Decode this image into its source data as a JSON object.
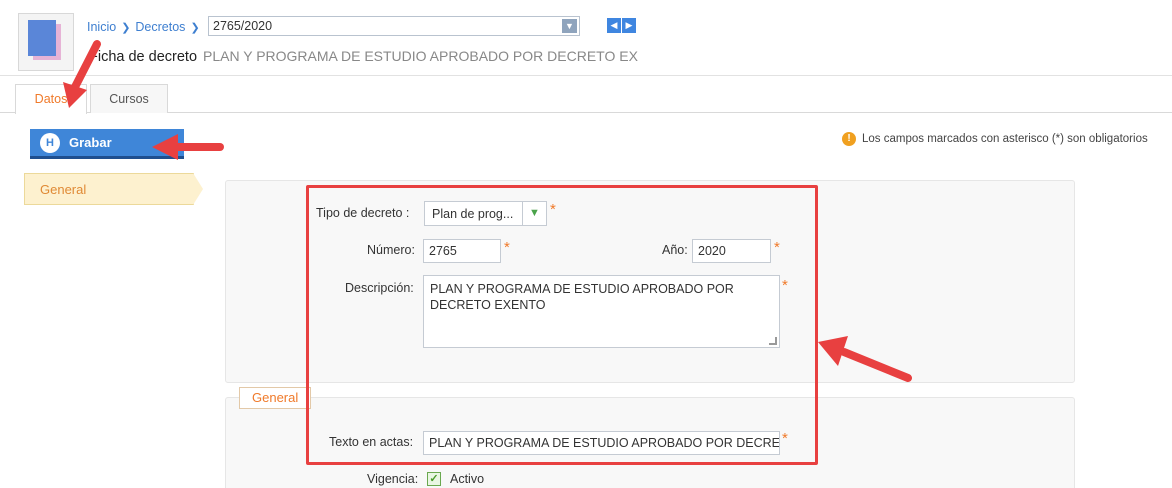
{
  "breadcrumb": {
    "home": "Inicio",
    "section": "Decretos"
  },
  "record_selector": {
    "value": "2765/2020"
  },
  "page_title": {
    "label": "Ficha de decreto",
    "subtitle": "PLAN Y PROGRAMA DE ESTUDIO APROBADO POR DECRETO EX"
  },
  "tabs": [
    {
      "label": "Datos"
    },
    {
      "label": "Cursos"
    }
  ],
  "toolbar": {
    "save_label": "Grabar"
  },
  "required_note": "Los campos marcados con asterisco (*) son obligatorios",
  "sidebar": {
    "general_label": "General"
  },
  "form": {
    "tipo_label": "Tipo de decreto :",
    "tipo_value": "Plan de prog...",
    "numero_label": "Número:",
    "numero_value": "2765",
    "anio_label": "Año:",
    "anio_value": "2020",
    "descripcion_label": "Descripción:",
    "descripcion_value": "PLAN Y PROGRAMA DE ESTUDIO APROBADO POR DECRETO EXENTO",
    "fieldset_legend": "General",
    "texto_actas_label": "Texto en actas:",
    "texto_actas_value": "PLAN Y PROGRAMA DE ESTUDIO APROBADO POR DECRET",
    "vigencia_label": "Vigencia:",
    "vigencia_value": "Activo",
    "required_mark": "*"
  },
  "icons": {
    "document": "document-icon",
    "breadcrumb_sep": "chevron-right-icon",
    "dropdown": "caret-down-icon",
    "prev": "arrow-left-icon",
    "next": "arrow-right-icon",
    "save": "floppy-disk-icon",
    "info": "info-icon",
    "check": "checkbox-checked-icon"
  },
  "colors": {
    "accent": "#f07a2a",
    "primary": "#3f86d8",
    "annotation": "#e84040"
  }
}
